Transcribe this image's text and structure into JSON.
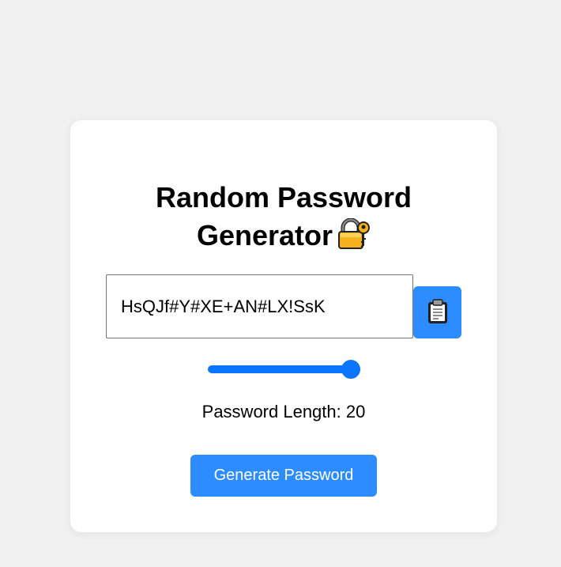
{
  "card": {
    "title_line1": "Random Password",
    "title_line2": "Generator",
    "title_icon": "lock-with-key-icon"
  },
  "password": {
    "value": "HsQJf#Y#XE+AN#LX!SsK"
  },
  "copy_button": {
    "icon": "clipboard-icon"
  },
  "length_slider": {
    "value": 20,
    "fill_fraction": 1.0
  },
  "length_label": {
    "text": "Password Length: 20"
  },
  "generate_button": {
    "label": "Generate Password"
  },
  "colors": {
    "accent": "#2d8cff",
    "slider": "#0a75ff",
    "background": "#f0f0f0",
    "card": "#ffffff"
  }
}
